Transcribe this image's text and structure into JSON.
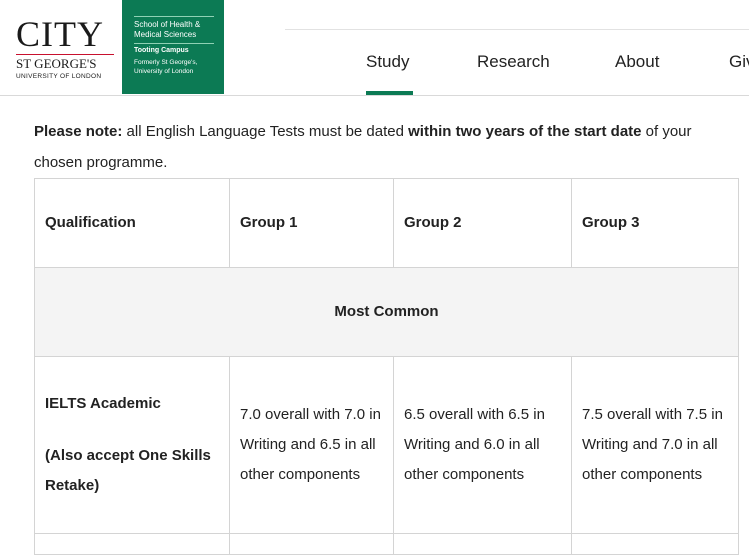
{
  "header": {
    "logo": {
      "city": "CITY",
      "st_georges": "ST GEORGE'S",
      "university": "UNIVERSITY OF LONDON",
      "school": "School of Health & Medical Sciences",
      "campus": "Tooting Campus",
      "formerly": "Formerly St George's, University of London",
      "brand_color": "#0c7a54"
    },
    "nav": [
      {
        "label": "Study",
        "active": true
      },
      {
        "label": "Research",
        "active": false
      },
      {
        "label": "About",
        "active": false
      },
      {
        "label": "Giv",
        "active": false
      }
    ]
  },
  "note": {
    "lead": "Please note:",
    "text1": " all English Language Tests must be dated ",
    "emphasis": "within two years of the start date",
    "text2": " of your chosen programme."
  },
  "table": {
    "headers": [
      "Qualification",
      "Group 1",
      "Group 2",
      "Group 3"
    ],
    "section_label": "Most Common",
    "rows": [
      {
        "qualification": "IELTS Academic",
        "qualification_note": "(Also accept One Skills Retake)",
        "group1": "7.0 overall with 7.0 in Writing and 6.5 in all other components",
        "group2": "6.5 overall with 6.5 in Writing and 6.0 in all other components",
        "group3": "7.5 overall with 7.5 in Writing and 7.0 in all other components"
      }
    ]
  }
}
